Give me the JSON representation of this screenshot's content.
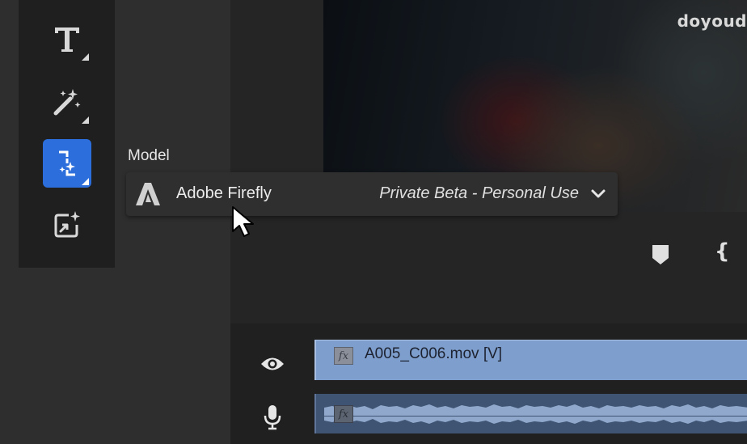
{
  "toolbar": {
    "tools": [
      {
        "name": "text-tool",
        "icon": "text-icon"
      },
      {
        "name": "magic-wand-tool",
        "icon": "magic-wand-icon"
      },
      {
        "name": "generative-extend-tool",
        "icon": "generative-extend-icon",
        "active": true
      },
      {
        "name": "generative-fill-tool",
        "icon": "generative-sparkle-icon"
      }
    ]
  },
  "preview": {
    "watermark": "doyoud"
  },
  "model": {
    "label": "Model",
    "selected_name": "Adobe Firefly",
    "selected_license": "Private Beta - Personal Use"
  },
  "timeline": {
    "video_clip": {
      "fx": "fx",
      "name": "A005_C006.mov [V]"
    },
    "audio_clip": {
      "fx": "fx"
    }
  },
  "colors": {
    "accent": "#2c6fdc",
    "video_clip": "#7e9fcd",
    "audio_clip": "#3f5472"
  }
}
